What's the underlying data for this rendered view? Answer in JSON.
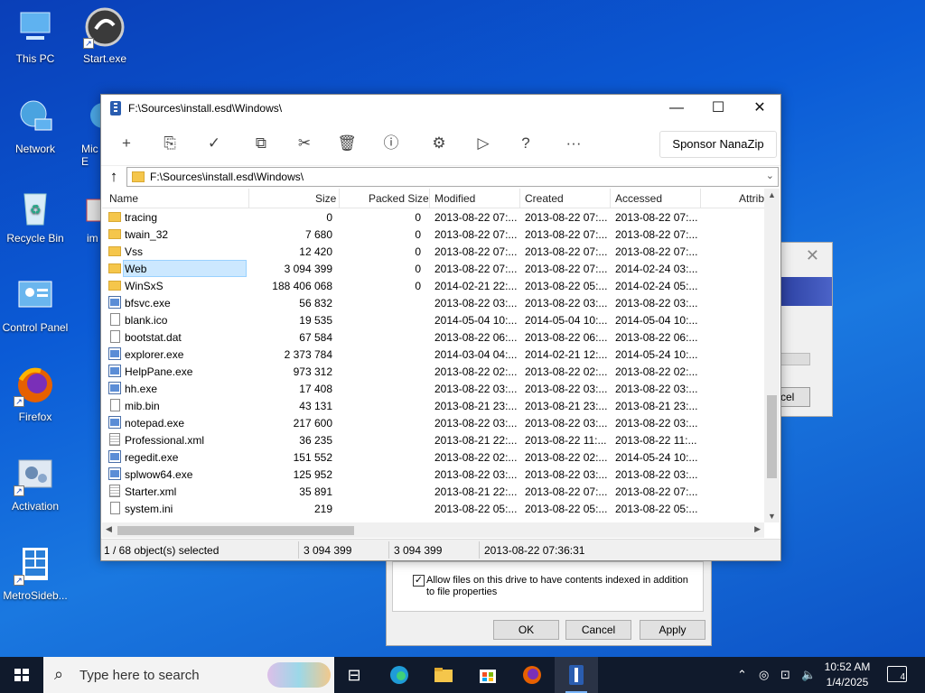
{
  "desktop": {
    "icons": [
      {
        "label": "This PC",
        "icon": "this-pc-icon"
      },
      {
        "label": "Start.exe",
        "icon": "start-exe-icon"
      },
      {
        "label": "Network",
        "icon": "network-icon"
      },
      {
        "label": "Mic E",
        "icon": "partial-icon"
      },
      {
        "label": "Recycle Bin",
        "icon": "recycle-bin-icon"
      },
      {
        "label": "im",
        "icon": "partial-icon"
      },
      {
        "label": "Control Panel",
        "icon": "control-panel-icon"
      },
      {
        "label": "Firefox",
        "icon": "firefox-icon"
      },
      {
        "label": "Activation",
        "icon": "activation-icon"
      },
      {
        "label": "MetroSideb...",
        "icon": "metro-sidebar-icon"
      }
    ]
  },
  "background_dialog": {
    "close": "✕",
    "cancel_partial": "cel"
  },
  "properties_dialog": {
    "checkbox_text": "Allow files on this drive to have contents indexed in addition to file properties",
    "checked": true,
    "ok": "OK",
    "cancel": "Cancel",
    "apply": "Apply"
  },
  "window": {
    "title": "F:\\Sources\\install.esd\\Windows\\",
    "minimize": "—",
    "maximize": "☐",
    "close": "✕",
    "toolbar": {
      "add": "+",
      "extract": "⎘",
      "test": "✓",
      "copy": "⧉",
      "cut": "✂",
      "delete": "🗑",
      "info": "ⓘ",
      "settings": "⚙",
      "run": "▷",
      "help": "?",
      "more": "···",
      "sponsor": "Sponsor NanaZip"
    },
    "address": "F:\\Sources\\install.esd\\Windows\\",
    "columns": {
      "name": "Name",
      "size": "Size",
      "packed": "Packed Size",
      "modified": "Modified",
      "created": "Created",
      "accessed": "Accessed",
      "attrib": "Attrib"
    },
    "rows": [
      {
        "name": "tracing",
        "type": "folder",
        "size": "0",
        "packed": "0",
        "modified": "2013-08-22 07:...",
        "created": "2013-08-22 07:...",
        "accessed": "2013-08-22 07:..."
      },
      {
        "name": "twain_32",
        "type": "folder",
        "size": "7 680",
        "packed": "0",
        "modified": "2013-08-22 07:...",
        "created": "2013-08-22 07:...",
        "accessed": "2013-08-22 07:..."
      },
      {
        "name": "Vss",
        "type": "folder",
        "size": "12 420",
        "packed": "0",
        "modified": "2013-08-22 07:...",
        "created": "2013-08-22 07:...",
        "accessed": "2013-08-22 07:..."
      },
      {
        "name": "Web",
        "type": "folder",
        "size": "3 094 399",
        "packed": "0",
        "modified": "2013-08-22 07:...",
        "created": "2013-08-22 07:...",
        "accessed": "2014-02-24 03:...",
        "selected": true
      },
      {
        "name": "WinSxS",
        "type": "folder",
        "size": "188 406 068",
        "packed": "0",
        "modified": "2014-02-21 22:...",
        "created": "2013-08-22 05:...",
        "accessed": "2014-02-24 05:..."
      },
      {
        "name": "bfsvc.exe",
        "type": "exe",
        "size": "56 832",
        "packed": "",
        "modified": "2013-08-22 03:...",
        "created": "2013-08-22 03:...",
        "accessed": "2013-08-22 03:..."
      },
      {
        "name": "blank.ico",
        "type": "doc",
        "size": "19 535",
        "packed": "",
        "modified": "2014-05-04 10:...",
        "created": "2014-05-04 10:...",
        "accessed": "2014-05-04 10:..."
      },
      {
        "name": "bootstat.dat",
        "type": "doc",
        "size": "67 584",
        "packed": "",
        "modified": "2013-08-22 06:...",
        "created": "2013-08-22 06:...",
        "accessed": "2013-08-22 06:..."
      },
      {
        "name": "explorer.exe",
        "type": "exe",
        "size": "2 373 784",
        "packed": "",
        "modified": "2014-03-04 04:...",
        "created": "2014-02-21 12:...",
        "accessed": "2014-05-24 10:..."
      },
      {
        "name": "HelpPane.exe",
        "type": "exe",
        "size": "973 312",
        "packed": "",
        "modified": "2013-08-22 02:...",
        "created": "2013-08-22 02:...",
        "accessed": "2013-08-22 02:..."
      },
      {
        "name": "hh.exe",
        "type": "exe",
        "size": "17 408",
        "packed": "",
        "modified": "2013-08-22 03:...",
        "created": "2013-08-22 03:...",
        "accessed": "2013-08-22 03:..."
      },
      {
        "name": "mib.bin",
        "type": "doc",
        "size": "43 131",
        "packed": "",
        "modified": "2013-08-21 23:...",
        "created": "2013-08-21 23:...",
        "accessed": "2013-08-21 23:..."
      },
      {
        "name": "notepad.exe",
        "type": "exe",
        "size": "217 600",
        "packed": "",
        "modified": "2013-08-22 03:...",
        "created": "2013-08-22 03:...",
        "accessed": "2013-08-22 03:..."
      },
      {
        "name": "Professional.xml",
        "type": "xml",
        "size": "36 235",
        "packed": "",
        "modified": "2013-08-21 22:...",
        "created": "2013-08-22 11:...",
        "accessed": "2013-08-22 11:..."
      },
      {
        "name": "regedit.exe",
        "type": "exe",
        "size": "151 552",
        "packed": "",
        "modified": "2013-08-22 02:...",
        "created": "2013-08-22 02:...",
        "accessed": "2014-05-24 10:..."
      },
      {
        "name": "splwow64.exe",
        "type": "exe",
        "size": "125 952",
        "packed": "",
        "modified": "2013-08-22 03:...",
        "created": "2013-08-22 03:...",
        "accessed": "2013-08-22 03:..."
      },
      {
        "name": "Starter.xml",
        "type": "xml",
        "size": "35 891",
        "packed": "",
        "modified": "2013-08-21 22:...",
        "created": "2013-08-22 07:...",
        "accessed": "2013-08-22 07:..."
      },
      {
        "name": "system.ini",
        "type": "doc",
        "size": "219",
        "packed": "",
        "modified": "2013-08-22 05:...",
        "created": "2013-08-22 05:...",
        "accessed": "2013-08-22 05:..."
      }
    ],
    "status": {
      "selection": "1 / 68 object(s) selected",
      "size": "3 094 399",
      "packed": "3 094 399",
      "modified": "2013-08-22 07:36:31"
    }
  },
  "taskbar": {
    "search_placeholder": "Type here to search",
    "time": "10:52 AM",
    "date": "1/4/2025",
    "notifications": "4",
    "apps": [
      "task-view-icon",
      "edge-icon",
      "file-explorer-icon",
      "store-icon",
      "firefox-icon",
      "nanazip-icon"
    ]
  },
  "colors": {
    "selection": "#cce8ff",
    "desktop": "#0b5bd6",
    "taskbar": "#101a2c"
  }
}
